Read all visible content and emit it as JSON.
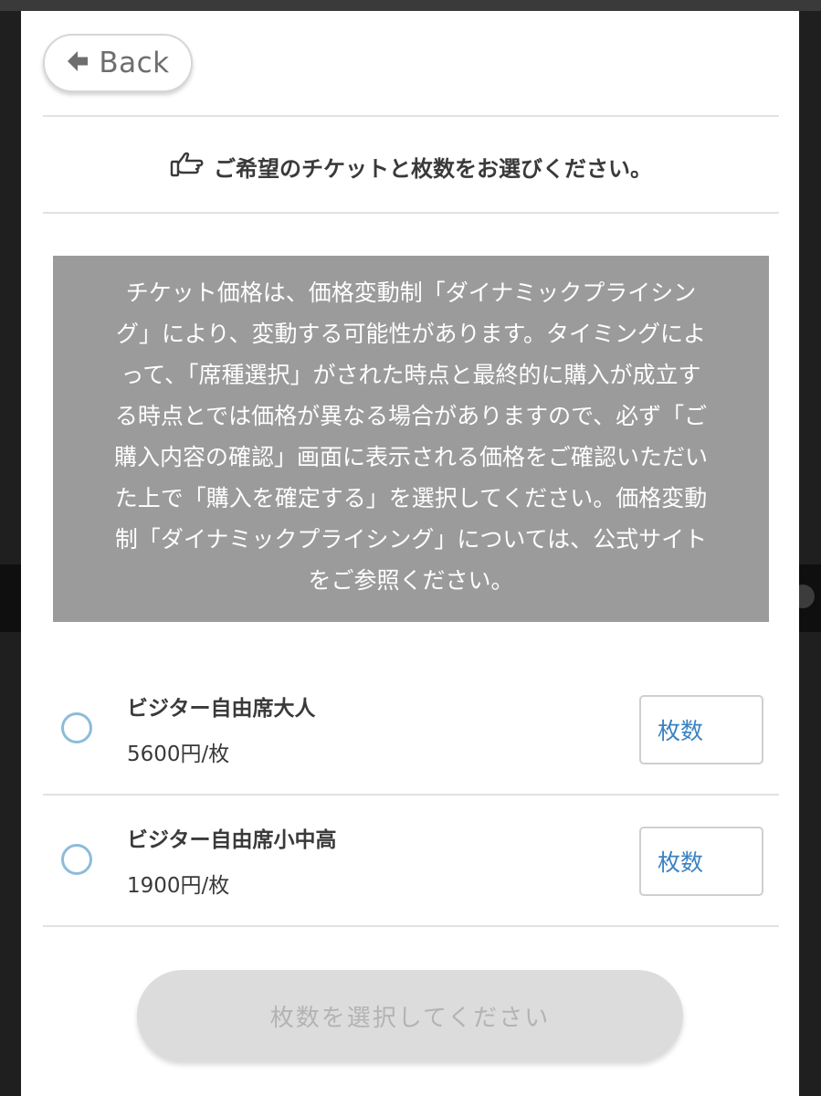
{
  "nav": {
    "back_label": "Back"
  },
  "heading": {
    "text": "ご希望のチケットと枚数をお選びください。"
  },
  "notice": {
    "lines": [
      "チケット価格は、価格変動制「ダイナミックプライシン",
      "グ」により、変動する可能性があります。タイミングによ",
      "って、「席種選択」がされた時点と最終的に購入が成立す",
      "る時点とでは価格が異なる場合がありますので、必ず「ご",
      "購入内容の確認」画面に表示される価格をご確認いただい",
      "た上で「購入を確定する」を選択してください。価格変動",
      "制「ダイナミックプライシング」については、公式サイト",
      "をご参照ください。"
    ]
  },
  "tickets": [
    {
      "name": "ビジター自由席大人",
      "price": "5600円/枚",
      "qty_placeholder": "枚数",
      "selected": false
    },
    {
      "name": "ビジター自由席小中高",
      "price": "1900円/枚",
      "qty_placeholder": "枚数",
      "selected": false
    }
  ],
  "submit": {
    "label": "枚数を選択してください",
    "enabled": false
  },
  "colors": {
    "accent_link": "#3b82c4",
    "radio_border": "#8cbcd9",
    "notice_bg": "#9b9b9b",
    "disabled_button_bg": "#dcdcdc"
  },
  "icons": {
    "back": "arrow-left-icon",
    "heading": "thumbs-point-icon"
  }
}
